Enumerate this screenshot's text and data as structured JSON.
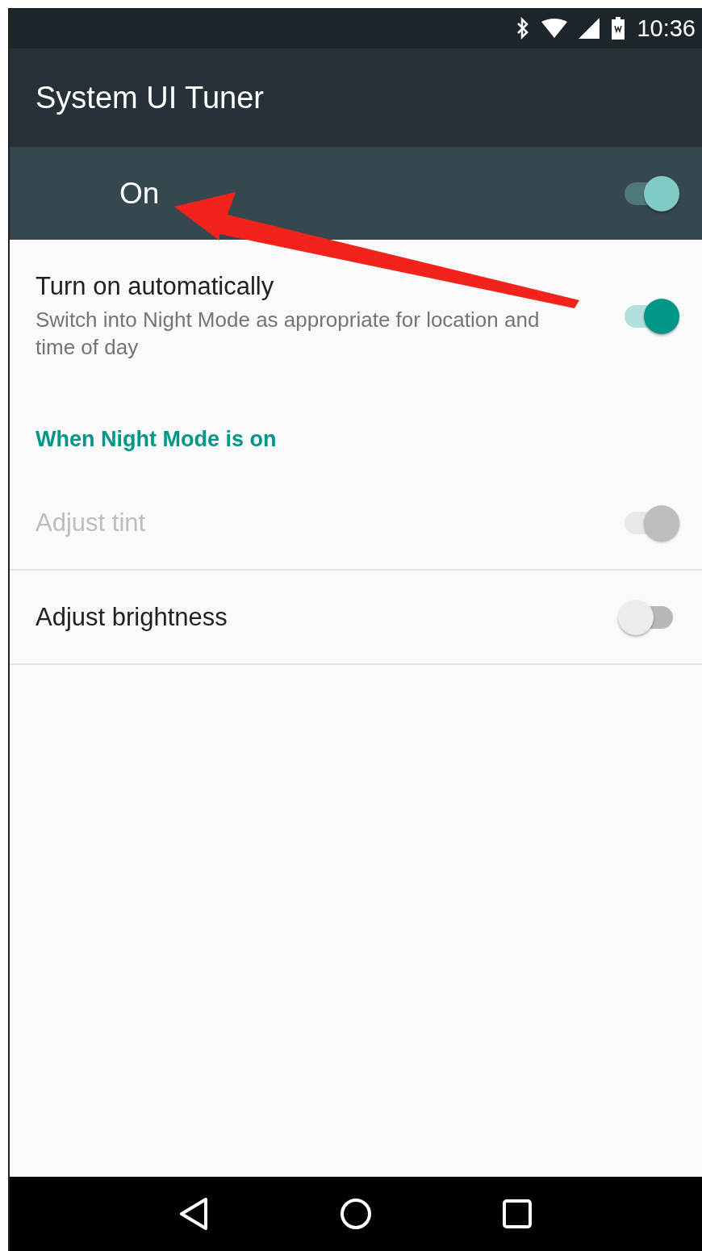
{
  "status_bar": {
    "time": "10:36"
  },
  "app_bar": {
    "title": "System UI Tuner"
  },
  "master_switch": {
    "label": "On",
    "on": true
  },
  "settings": [
    {
      "kind": "switch",
      "title": "Turn on automatically",
      "summary": "Switch into Night Mode as appropriate for location and time of day",
      "on": true,
      "disabled": false
    },
    {
      "kind": "category",
      "title": "When Night Mode is on"
    },
    {
      "kind": "switch",
      "title": "Adjust tint",
      "on": true,
      "disabled": true
    },
    {
      "kind": "switch",
      "title": "Adjust brightness",
      "on": false,
      "disabled": false
    }
  ]
}
